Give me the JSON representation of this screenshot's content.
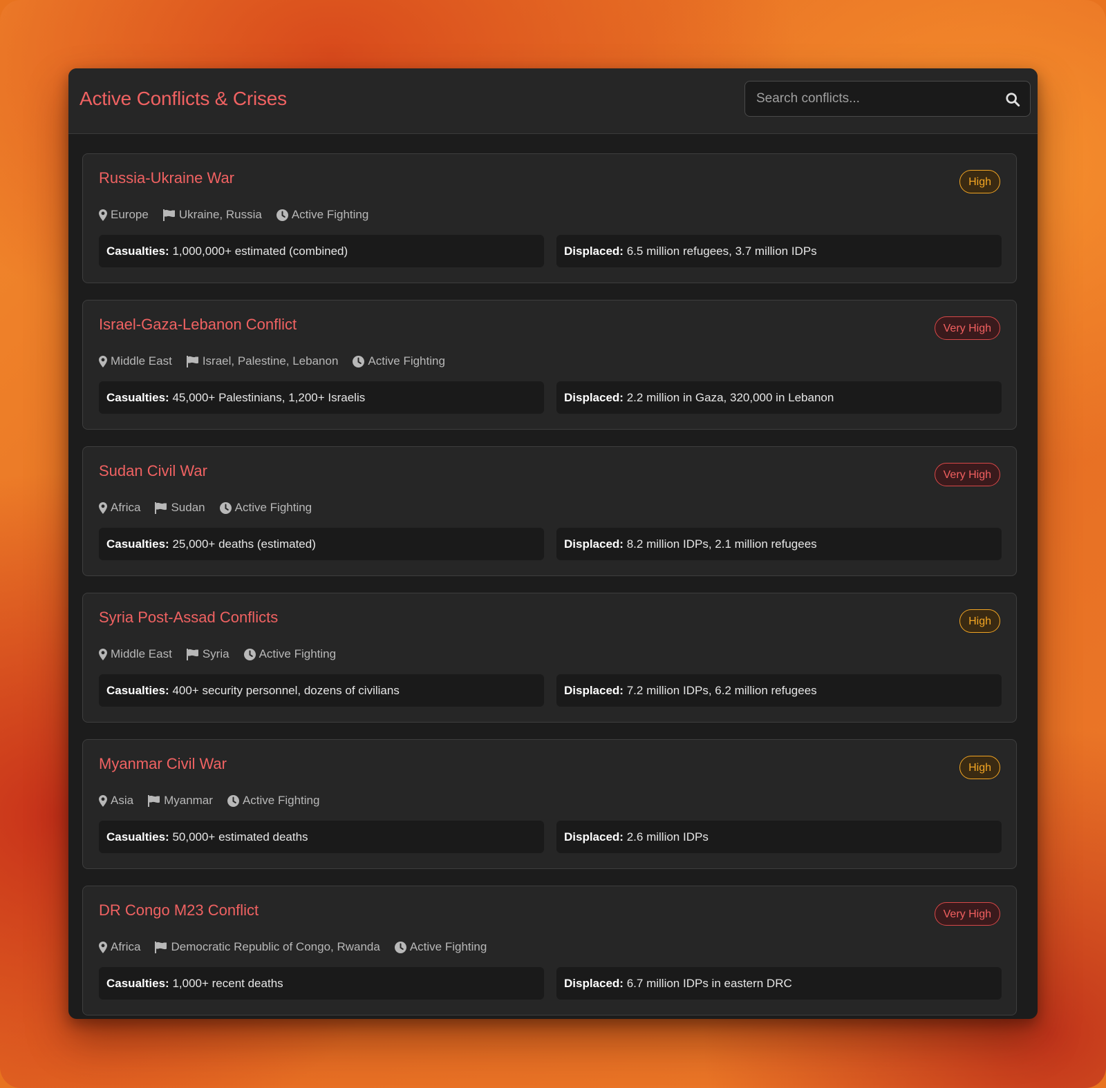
{
  "header": {
    "title": "Active Conflicts & Crises",
    "search_placeholder": "Search conflicts..."
  },
  "labels": {
    "casualties": "Casualties:",
    "displaced": "Displaced:"
  },
  "colors": {
    "accent": "#f06262",
    "badge_high": "#f4a623",
    "badge_very_high": "#f26060"
  },
  "conflicts": [
    {
      "title": "Russia-Ukraine War",
      "severity": "High",
      "region": "Europe",
      "parties": "Ukraine, Russia",
      "status": "Active Fighting",
      "casualties": "1,000,000+ estimated (combined)",
      "displaced": "6.5 million refugees, 3.7 million IDPs"
    },
    {
      "title": "Israel-Gaza-Lebanon Conflict",
      "severity": "Very High",
      "region": "Middle East",
      "parties": "Israel, Palestine, Lebanon",
      "status": "Active Fighting",
      "casualties": "45,000+ Palestinians, 1,200+ Israelis",
      "displaced": "2.2 million in Gaza, 320,000 in Lebanon"
    },
    {
      "title": "Sudan Civil War",
      "severity": "Very High",
      "region": "Africa",
      "parties": "Sudan",
      "status": "Active Fighting",
      "casualties": "25,000+ deaths (estimated)",
      "displaced": "8.2 million IDPs, 2.1 million refugees"
    },
    {
      "title": "Syria Post-Assad Conflicts",
      "severity": "High",
      "region": "Middle East",
      "parties": "Syria",
      "status": "Active Fighting",
      "casualties": "400+ security personnel, dozens of civilians",
      "displaced": "7.2 million IDPs, 6.2 million refugees"
    },
    {
      "title": "Myanmar Civil War",
      "severity": "High",
      "region": "Asia",
      "parties": "Myanmar",
      "status": "Active Fighting",
      "casualties": "50,000+ estimated deaths",
      "displaced": "2.6 million IDPs"
    },
    {
      "title": "DR Congo M23 Conflict",
      "severity": "Very High",
      "region": "Africa",
      "parties": "Democratic Republic of Congo, Rwanda",
      "status": "Active Fighting",
      "casualties": "1,000+ recent deaths",
      "displaced": "6.7 million IDPs in eastern DRC"
    }
  ]
}
